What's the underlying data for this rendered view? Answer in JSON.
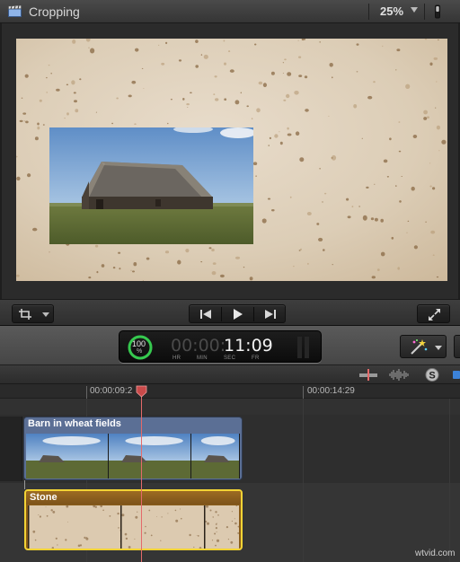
{
  "viewer": {
    "title": "Cropping",
    "zoom": "25%",
    "zoom_caret": "▾"
  },
  "icons": {
    "clapper": "clapperboard-icon",
    "view_options": "toggle-switch-icon",
    "transform": "transform-crop-icon",
    "dropdown": "chevron-down-icon",
    "prev": "skip-back-icon",
    "play": "play-icon",
    "next": "skip-forward-icon",
    "fullscreen": "fullscreen-icon",
    "enhance": "magic-wand-icon",
    "skimming": "skimming-icon",
    "audio_skimming": "audio-waveform-icon",
    "solo": "solo-icon"
  },
  "dashboard": {
    "progress_percent": "100",
    "progress_unit": "%",
    "timecode_dim": "00:00:",
    "timecode_bright": "11:09",
    "unit_hr": "HR",
    "unit_min": "MIN",
    "unit_sec": "SEC",
    "unit_fr": "FR"
  },
  "timeline": {
    "ruler": [
      "00:00:09:2",
      "00:00:14:29"
    ],
    "clips": [
      {
        "name": "Barn in wheat fields",
        "role": "connected-video"
      },
      {
        "name": "Stone",
        "role": "primary-storyline"
      }
    ]
  },
  "watermark": "wtvid.com",
  "colors": {
    "accent_blue": "#3c82d8",
    "playhead": "#e46a6a",
    "stone_clip_selected": "#f3d335",
    "connected_clip": "#5b6f95",
    "progress_green": "#36c94f"
  }
}
